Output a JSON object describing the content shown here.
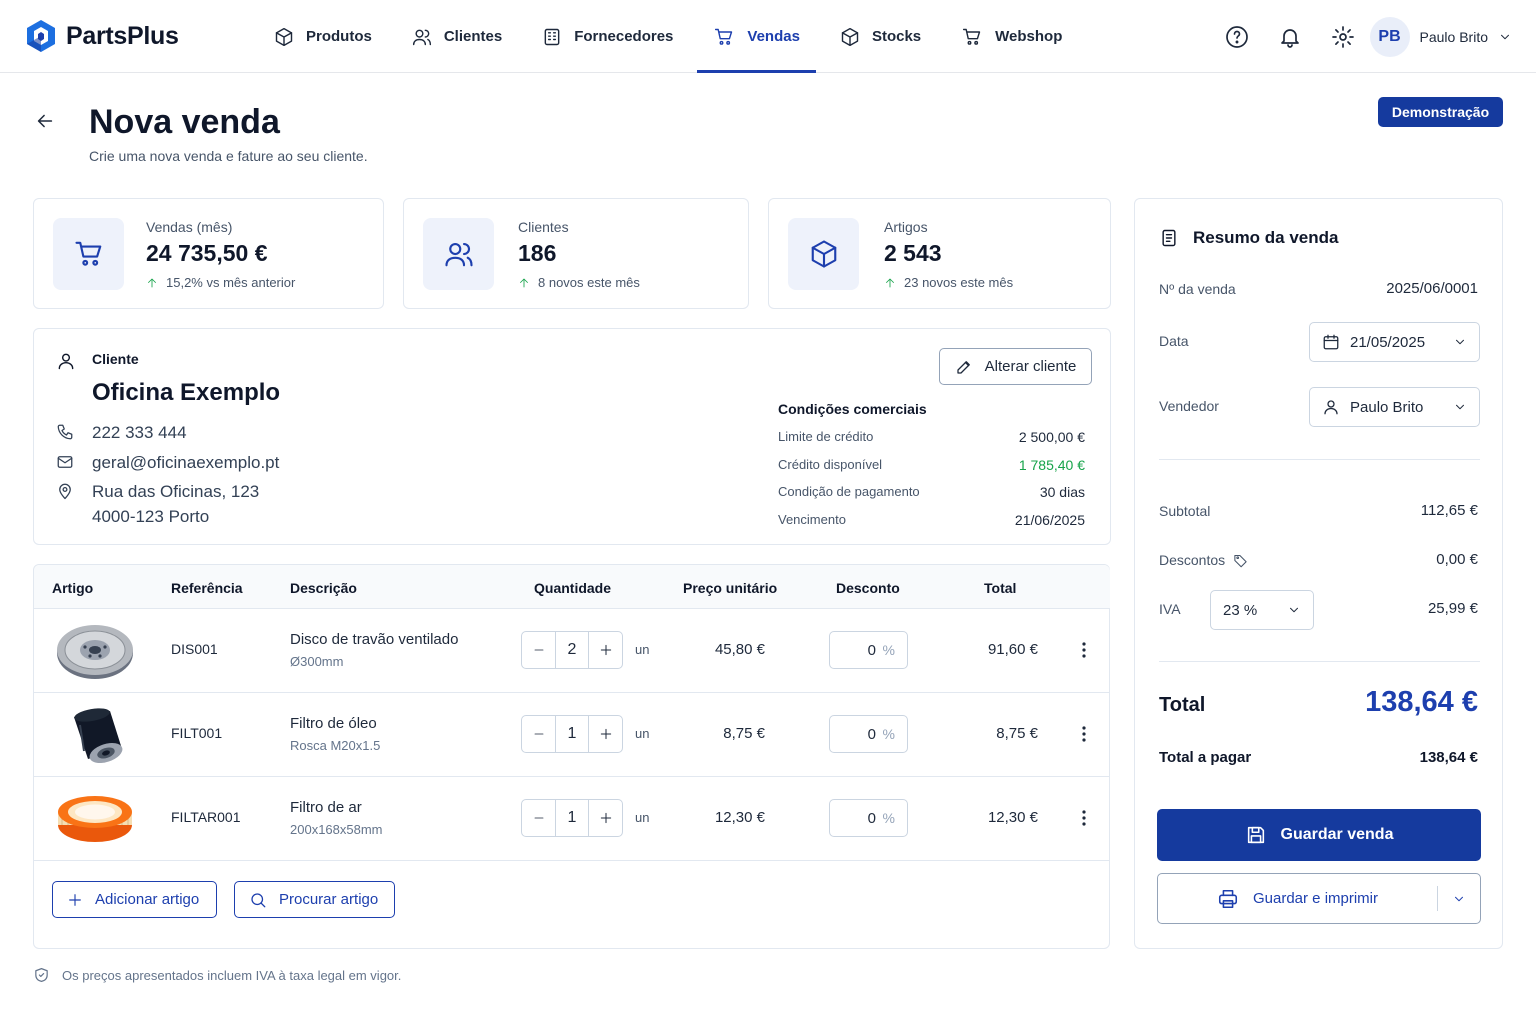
{
  "app": {
    "name": "PartsPlus"
  },
  "nav": [
    {
      "label": "Produtos",
      "icon": "box-icon"
    },
    {
      "label": "Clientes",
      "icon": "users-icon"
    },
    {
      "label": "Fornecedores",
      "icon": "building-icon"
    },
    {
      "label": "Vendas",
      "icon": "cart-icon",
      "active": true
    },
    {
      "label": "Stocks",
      "icon": "box-icon"
    },
    {
      "label": "Webshop",
      "icon": "cart-icon"
    }
  ],
  "user": {
    "initials": "PB",
    "name": "Paulo Brito"
  },
  "page": {
    "title": "Nova venda",
    "subtitle": "Crie uma nova venda e fature ao seu cliente.",
    "demo_label": "Demonstração"
  },
  "stats": [
    {
      "label": "Vendas (mês)",
      "value": "24 735,50 €",
      "note": "15,2% vs mês anterior",
      "icon": "cart-icon"
    },
    {
      "label": "Clientes",
      "value": "186",
      "note": "8 novos este mês",
      "icon": "users-icon"
    },
    {
      "label": "Artigos",
      "value": "2 543",
      "note": "23 novos este mês",
      "icon": "box-icon"
    }
  ],
  "client": {
    "label": "Cliente",
    "name": "Oficina Exemplo",
    "phone": "222 333 444",
    "email": "geral@oficinaexemplo.pt",
    "address_line1": "Rua das Oficinas, 123",
    "address_line2": "4000-123 Porto",
    "change_label": "Alterar cliente",
    "conditions_title": "Condições comerciais",
    "conditions": [
      {
        "label": "Limite de crédito",
        "value": "2 500,00 €"
      },
      {
        "label": "Crédito disponível",
        "value": "1 785,40 €"
      },
      {
        "label": "Condição de pagamento",
        "value": "30 dias"
      },
      {
        "label": "Vencimento",
        "value": "21/06/2025"
      }
    ]
  },
  "table": {
    "headers": {
      "artigo": "Artigo",
      "referencia": "Referência",
      "descricao": "Descrição",
      "quantidade": "Quantidade",
      "preco": "Preço unitário",
      "desconto": "Desconto",
      "total": "Total"
    },
    "rows": [
      {
        "ref": "DIS001",
        "desc": "Disco de travão ventilado",
        "sub": "Ø300mm",
        "qty": "2",
        "unit": "un",
        "price": "45,80 €",
        "discount": "0",
        "pct": "%",
        "total": "91,60 €"
      },
      {
        "ref": "FILT001",
        "desc": "Filtro de óleo",
        "sub": "Rosca M20x1.5",
        "qty": "1",
        "unit": "un",
        "price": "8,75 €",
        "discount": "0",
        "pct": "%",
        "total": "8,75 €"
      },
      {
        "ref": "FILTAR001",
        "desc": "Filtro de ar",
        "sub": "200x168x58mm",
        "qty": "1",
        "unit": "un",
        "price": "12,30 €",
        "discount": "0",
        "pct": "%",
        "total": "12,30 €"
      }
    ],
    "add_label": "Adicionar artigo",
    "search_label": "Procurar artigo"
  },
  "footnote": "Os preços apresentados incluem IVA à taxa legal em vigor.",
  "summary": {
    "title": "Resumo da venda",
    "number_label": "Nº da venda",
    "number": "2025/06/0001",
    "date_label": "Data",
    "date": "21/05/2025",
    "seller_label": "Vendedor",
    "seller": "Paulo Brito",
    "subtotal_label": "Subtotal",
    "subtotal": "112,65 €",
    "discounts_label": "Descontos",
    "discounts": "0,00 €",
    "vat_label": "IVA",
    "vat_rate": "23 %",
    "vat": "25,99 €",
    "total_label": "Total",
    "total": "138,64 €",
    "to_pay_label": "Total a pagar",
    "to_pay": "138,64 €",
    "save_label": "Guardar venda",
    "save_print_label": "Guardar e imprimir"
  },
  "colors": {
    "accent": "#1d3fae",
    "primary_button": "#153a9e",
    "positive": "#16a34a",
    "border": "#e2e8f0"
  }
}
